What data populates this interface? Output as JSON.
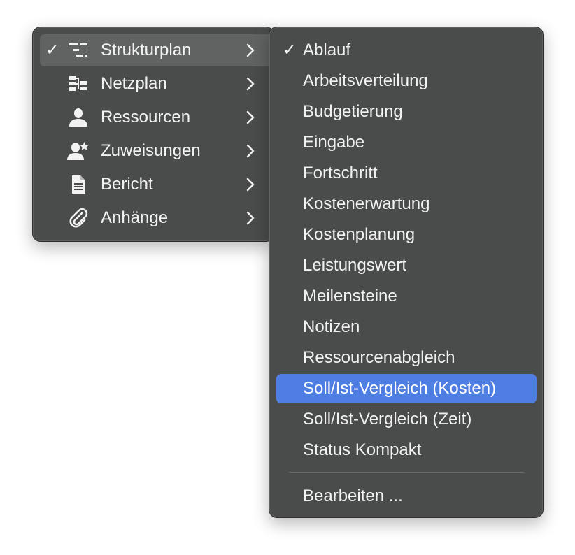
{
  "main_menu": {
    "items": [
      {
        "label": "Strukturplan",
        "checked": true,
        "icon": "structure-plan-icon"
      },
      {
        "label": "Netzplan",
        "checked": false,
        "icon": "network-plan-icon"
      },
      {
        "label": "Ressourcen",
        "checked": false,
        "icon": "person-icon"
      },
      {
        "label": "Zuweisungen",
        "checked": false,
        "icon": "person-star-icon"
      },
      {
        "label": "Bericht",
        "checked": false,
        "icon": "document-icon"
      },
      {
        "label": "Anhänge",
        "checked": false,
        "icon": "paperclip-icon"
      }
    ]
  },
  "sub_menu": {
    "items": [
      {
        "label": "Ablauf",
        "checked": true
      },
      {
        "label": "Arbeitsverteilung"
      },
      {
        "label": "Budgetierung"
      },
      {
        "label": "Eingabe"
      },
      {
        "label": "Fortschritt"
      },
      {
        "label": "Kostenerwartung"
      },
      {
        "label": "Kostenplanung"
      },
      {
        "label": "Leistungswert"
      },
      {
        "label": "Meilensteine"
      },
      {
        "label": "Notizen"
      },
      {
        "label": "Ressourcenabgleich"
      },
      {
        "label": "Soll/Ist-Vergleich (Kosten)",
        "highlighted": true
      },
      {
        "label": "Soll/Ist-Vergleich (Zeit)"
      },
      {
        "label": "Status Kompakt"
      }
    ],
    "edit_label": "Bearbeiten ..."
  },
  "check_glyph": "✓",
  "colors": {
    "menu_background": "#4a4b4b",
    "highlight": "#4f7ee3",
    "active_row": "#616262",
    "text": "#f2f2f2"
  }
}
